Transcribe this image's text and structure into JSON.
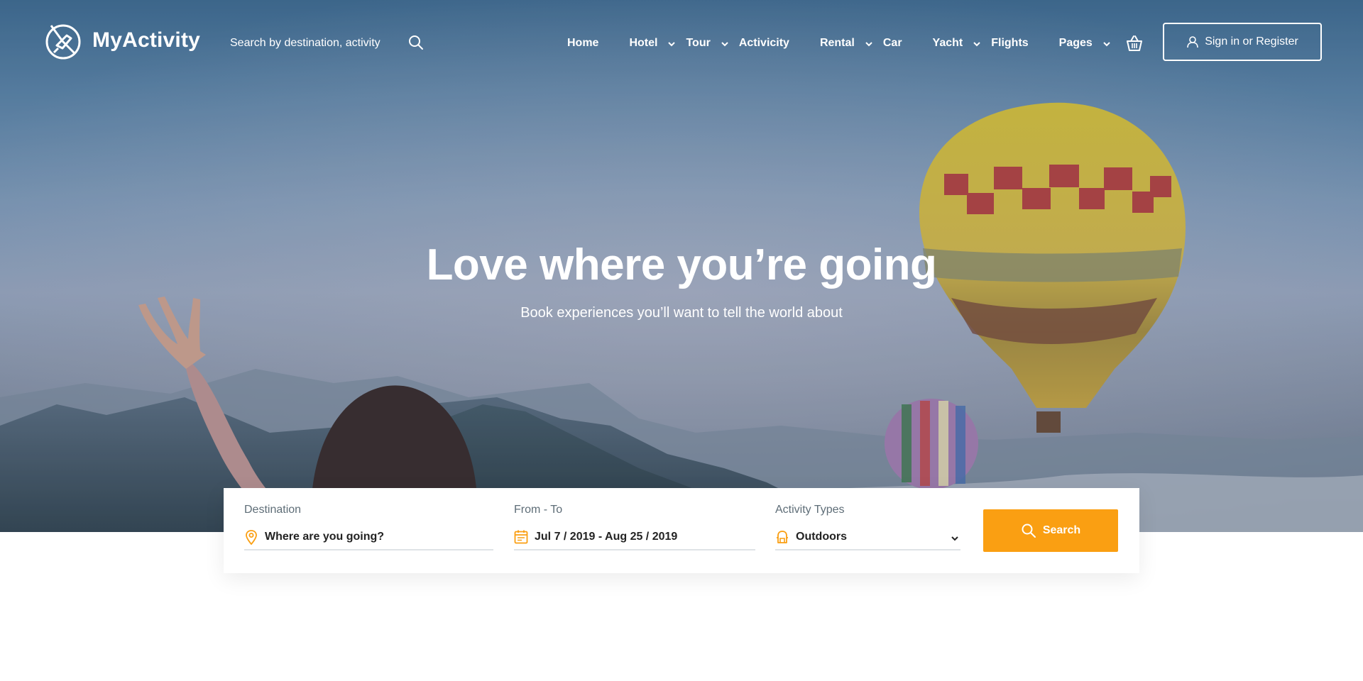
{
  "header": {
    "brand": "MyActivity",
    "search_placeholder": "Search by destination, activity",
    "nav": [
      {
        "label": "Home",
        "has_dropdown": false
      },
      {
        "label": "Hotel",
        "has_dropdown": true
      },
      {
        "label": "Tour",
        "has_dropdown": true
      },
      {
        "label": "Activicity",
        "has_dropdown": false
      },
      {
        "label": "Rental",
        "has_dropdown": true
      },
      {
        "label": "Car",
        "has_dropdown": false
      },
      {
        "label": "Yacht",
        "has_dropdown": true
      },
      {
        "label": "Flights",
        "has_dropdown": false
      },
      {
        "label": "Pages",
        "has_dropdown": true
      }
    ],
    "signin_label": "Sign in or Register"
  },
  "hero": {
    "headline": "Love where you’re going",
    "subline": "Book experiences you’ll want to tell the world about"
  },
  "search_form": {
    "destination": {
      "label": "Destination",
      "value": "Where are you going?"
    },
    "dates": {
      "label": "From - To",
      "value": "Jul 7 / 2019 - Aug 25 / 2019"
    },
    "activity": {
      "label": "Activity Types",
      "selected": "Outdoors"
    },
    "button_label": "Search"
  },
  "icons": {
    "logo": "logo-icon",
    "search": "search-icon",
    "basket": "basket-icon",
    "user": "user-icon",
    "pin": "location-pin-icon",
    "calendar": "calendar-icon",
    "activity": "backpack-icon",
    "chevron": "chevron-down-icon"
  },
  "colors": {
    "accent": "#fa9f12",
    "text_dark": "#232323",
    "label_gray": "#5e6d77"
  }
}
